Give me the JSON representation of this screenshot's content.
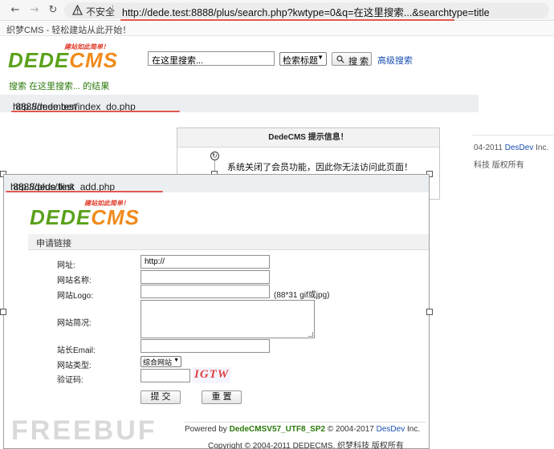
{
  "browser": {
    "back_icon": "arrow-left-icon",
    "forward_icon": "arrow-right-icon",
    "reload_icon": "reload-icon",
    "insecure_label": "不安全",
    "url_host": "http://dede.test",
    "url_rest": ":8888/plus/search.php?kwtype=0&q=在这里搜索...&searchtype=title"
  },
  "site_bar": "织梦CMS - 轻松建站从此开始！",
  "logo": {
    "dede": "DEDE",
    "cms": "CMS",
    "slogan": "建站如此简单！"
  },
  "search": {
    "value": "在这里搜索...",
    "type_selected": "检索标题",
    "button": "搜 索",
    "advanced": "高级搜索"
  },
  "result": {
    "prefix": "搜索",
    "query": "在这里搜索...",
    "suffix": "的结果"
  },
  "member_url": {
    "host": "http://dede.test",
    "rest": ":8888/member/index_do.php"
  },
  "info_box": {
    "title": "DedeCMS 提示信息！",
    "message": "系统关闭了会员功能，因此你无法访问此页面！"
  },
  "bg_footer": {
    "copyright_fragment": "04-2011 ",
    "dev_link": "DesDev",
    "inc": " Inc.",
    "rights": "科技 版权所有"
  },
  "flink_url": {
    "host": "http://dede.test",
    "rest": ":8888/plus/flink_add.php"
  },
  "apply_title": "申请链接",
  "form": {
    "url_label": "网址:",
    "url_value": "http://",
    "name_label": "网站名称:",
    "logo_label": "网站Logo:",
    "logo_hint": "(88*31 gif或jpg)",
    "desc_label": "网站简况:",
    "email_label": "站长Email:",
    "type_label": "网站类型:",
    "type_selected": "综合网站",
    "captcha_label": "验证码:",
    "captcha_text": "IGTW",
    "submit": "提 交",
    "reset": "重 置"
  },
  "footer": {
    "powered_prefix": "Powered by ",
    "powered_link": "DedeCMSV57_UTF8_SP2",
    "powered_suffix": " © 2004-2017 ",
    "dev_link": "DesDev",
    "inc": " Inc.",
    "copyright": "Copyright © 2004-2011 DEDECMS. 织梦科技 版权所有"
  },
  "watermark": "FREEBUF",
  "colors": {
    "accent_red": "#e2574c",
    "logo_green": "#5aa11a",
    "logo_orange": "#f08b1c",
    "link_blue": "#1a4fb0"
  }
}
